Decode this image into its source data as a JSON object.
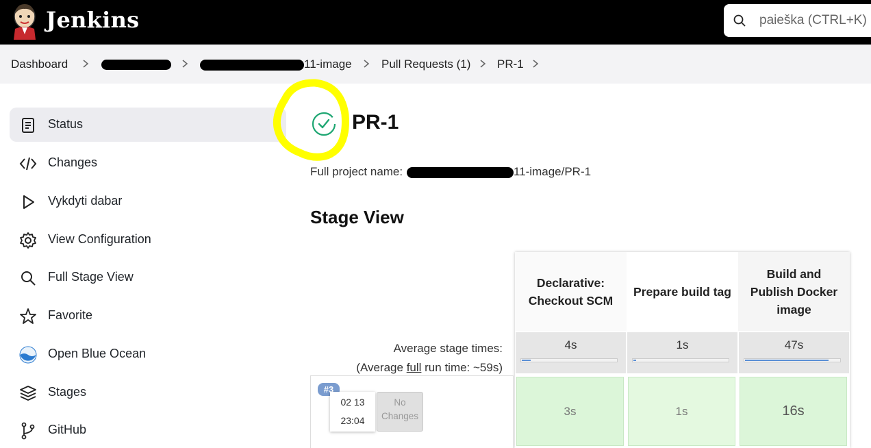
{
  "header": {
    "brand": "Jenkins",
    "search_placeholder": "paieška (CTRL+K)"
  },
  "breadcrumb": {
    "items": [
      "Dashboard",
      "",
      "11-image",
      "Pull Requests (1)",
      "PR-1"
    ]
  },
  "sidebar": {
    "items": [
      {
        "label": "Status",
        "icon": "document-icon",
        "active": true
      },
      {
        "label": "Changes",
        "icon": "code-icon"
      },
      {
        "label": "Vykdyti dabar",
        "icon": "play-icon"
      },
      {
        "label": "View Configuration",
        "icon": "gear-icon"
      },
      {
        "label": "Full Stage View",
        "icon": "search-icon"
      },
      {
        "label": "Favorite",
        "icon": "star-icon"
      },
      {
        "label": "Open Blue Ocean",
        "icon": "blue-ocean-icon"
      },
      {
        "label": "Stages",
        "icon": "stages-icon"
      },
      {
        "label": "GitHub",
        "icon": "git-branch-icon"
      }
    ]
  },
  "main": {
    "title": "PR-1",
    "status": "success",
    "full_name_label": "Full project name:",
    "full_name_suffix": "11-image/PR-1",
    "stage_view_heading": "Stage View"
  },
  "stage_view": {
    "avg_label_line1": "Average stage times:",
    "avg_label_line2_pre": "(Average ",
    "avg_label_link": "full",
    "avg_label_line2_post": " run time: ~59s)",
    "stages": [
      {
        "name": "Declarative: Checkout SCM",
        "avg": "4s",
        "avg_fraction": 0.09,
        "run": "3s"
      },
      {
        "name": "Prepare build tag",
        "avg": "1s",
        "avg_fraction": 0.03,
        "run": "1s"
      },
      {
        "name": "Build and Publish Docker image",
        "avg": "47s",
        "avg_fraction": 0.87,
        "run": "16s"
      }
    ],
    "build": {
      "number": "#3",
      "date": "02 13",
      "time": "23:04",
      "changes": "No Changes"
    }
  },
  "colors": {
    "header_bg": "#000000",
    "success_green": "#1ea672",
    "stage_success": "#dcf6d9",
    "highlight": "#ffff00",
    "badge_blue": "#7a9ccf"
  }
}
